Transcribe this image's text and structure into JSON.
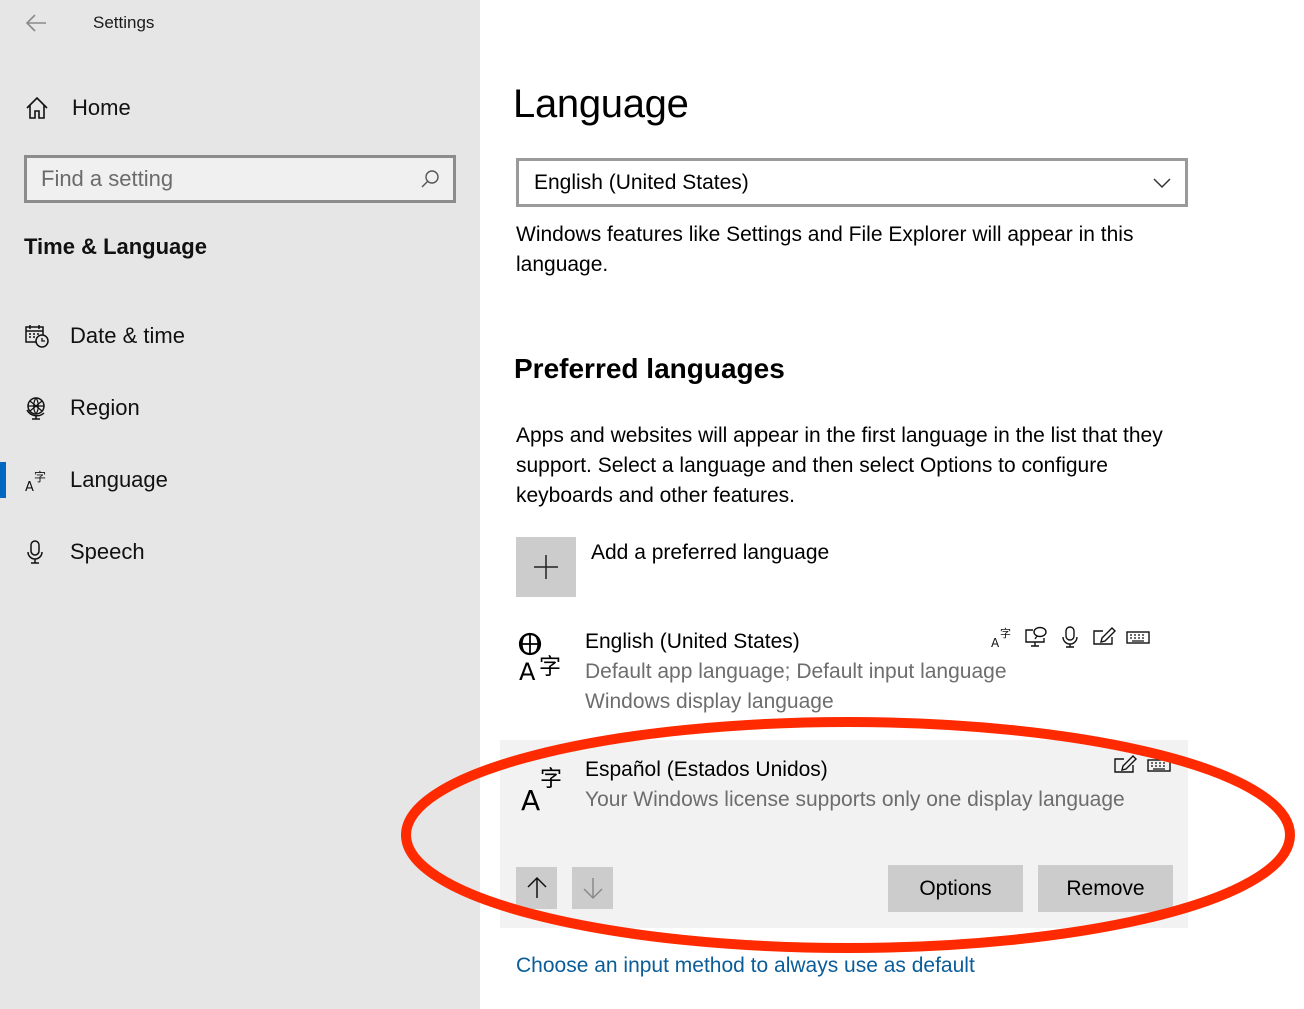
{
  "window": {
    "title": "Settings",
    "back_icon": "back-arrow-icon"
  },
  "sidebar": {
    "home_label": "Home",
    "home_icon": "home-icon",
    "search_placeholder": "Find a setting",
    "search_value": "",
    "search_icon": "search-icon",
    "section_title": "Time & Language",
    "items": [
      {
        "label": "Date & time",
        "icon": "calendar-clock-icon",
        "selected": false
      },
      {
        "label": "Region",
        "icon": "globe-icon",
        "selected": false
      },
      {
        "label": "Language",
        "icon": "language-icon",
        "selected": true
      },
      {
        "label": "Speech",
        "icon": "microphone-icon",
        "selected": false
      }
    ],
    "accent_color": "#0067c0"
  },
  "main": {
    "title": "Language",
    "display_language": {
      "selected": "English (United States)",
      "description": "Windows features like Settings and File Explorer will appear in this language."
    },
    "preferred": {
      "title": "Preferred languages",
      "description": "Apps and websites will appear in the first language in the list that they support. Select a language and then select Options to configure keyboards and other features.",
      "add_label": "Add a preferred language",
      "languages": [
        {
          "name": "English (United States)",
          "lines": [
            "Default app language; Default input language",
            "Windows display language"
          ],
          "feature_icons": [
            "language-pack-icon",
            "text-to-speech-icon",
            "speech-icon",
            "handwriting-icon",
            "keyboard-icon"
          ],
          "selected": false
        },
        {
          "name": "Español (Estados Unidos)",
          "lines": [
            "Your Windows license supports only one display language"
          ],
          "feature_icons": [
            "handwriting-icon",
            "keyboard-icon"
          ],
          "selected": true,
          "buttons": {
            "up": "move-up",
            "down": "move-down",
            "options": "Options",
            "remove": "Remove"
          }
        }
      ]
    },
    "link": "Choose an input method to always use as default",
    "link_color": "#0a5d99"
  },
  "annotation": {
    "shape": "ellipse",
    "color": "#ff2a00",
    "highlights": "Español (Estados Unidos)"
  }
}
